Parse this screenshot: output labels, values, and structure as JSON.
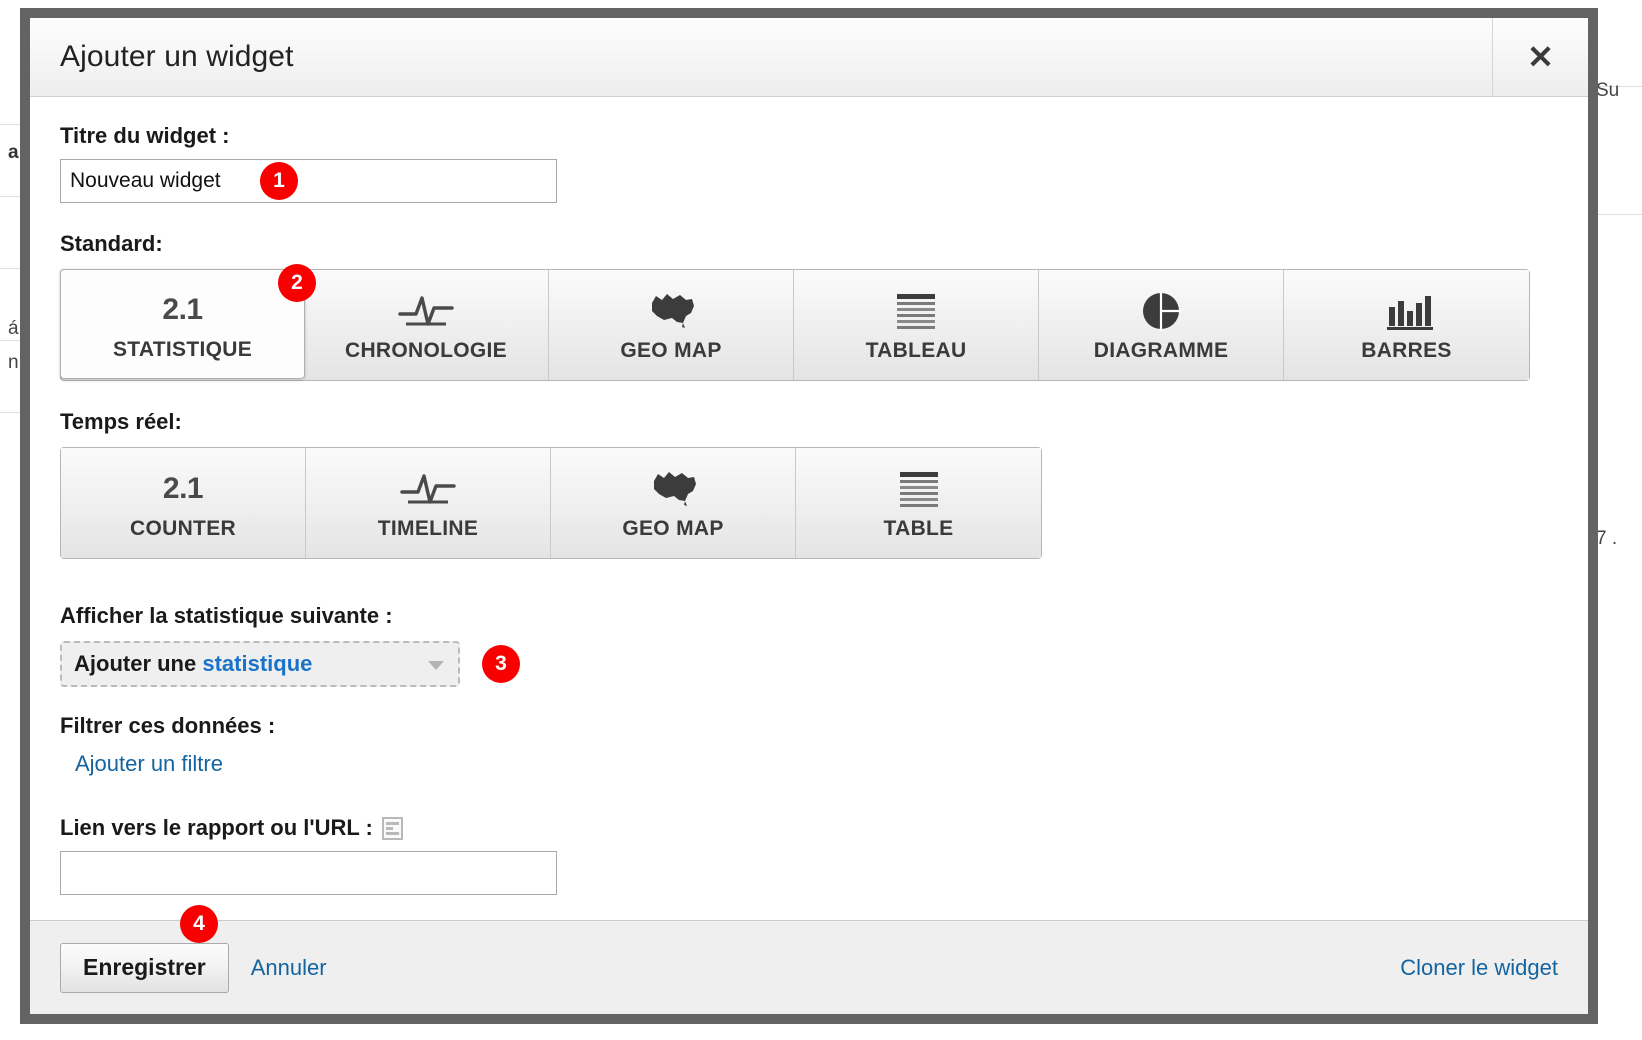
{
  "dialog": {
    "title": "Ajouter un widget",
    "close_icon": "close-icon"
  },
  "form": {
    "title_label": "Titre du widget :",
    "title_value": "Nouveau widget",
    "title_placeholder": "",
    "standard_label": "Standard:",
    "realtime_label": "Temps réel:",
    "statistic_label": "Afficher la statistique suivante :",
    "dropdown_prefix": "Ajouter une ",
    "dropdown_accent": "statistique",
    "filter_label": "Filtrer ces données :",
    "filter_link": "Ajouter un filtre",
    "url_label": "Lien vers le rapport ou l'URL :",
    "url_icon": "report-icon",
    "url_value": "",
    "url_placeholder": ""
  },
  "standard_types": [
    {
      "label": "STATISTIQUE",
      "icon": "numeral-2-1-icon",
      "icon_text": "2.1",
      "selected": true
    },
    {
      "label": "CHRONOLOGIE",
      "icon": "timeline-line-icon",
      "icon_text": "",
      "selected": false
    },
    {
      "label": "GEO MAP",
      "icon": "geo-map-icon",
      "icon_text": "",
      "selected": false
    },
    {
      "label": "TABLEAU",
      "icon": "table-rows-icon",
      "icon_text": "",
      "selected": false
    },
    {
      "label": "DIAGRAMME",
      "icon": "pie-chart-icon",
      "icon_text": "",
      "selected": false
    },
    {
      "label": "BARRES",
      "icon": "bar-chart-icon",
      "icon_text": "",
      "selected": false
    }
  ],
  "realtime_types": [
    {
      "label": "COUNTER",
      "icon": "numeral-2-1-icon",
      "icon_text": "2.1",
      "selected": false
    },
    {
      "label": "TIMELINE",
      "icon": "timeline-line-icon",
      "icon_text": "",
      "selected": false
    },
    {
      "label": "GEO MAP",
      "icon": "geo-map-icon",
      "icon_text": "",
      "selected": false
    },
    {
      "label": "TABLE",
      "icon": "table-rows-icon",
      "icon_text": "",
      "selected": false
    }
  ],
  "footer": {
    "save_label": "Enregistrer",
    "cancel_label": "Annuler",
    "clone_label": "Cloner le widget"
  },
  "badges": [
    {
      "number": "1",
      "target": "title-input"
    },
    {
      "number": "2",
      "target": "statistique-type-button"
    },
    {
      "number": "3",
      "target": "statistic-dropdown"
    },
    {
      "number": "4",
      "target": "save-button"
    }
  ],
  "background_fragments": {
    "left": [
      "a",
      "á",
      "n"
    ],
    "right": [
      "Su",
      "7 ."
    ]
  },
  "colors": {
    "badge_red": "#f90000",
    "link_blue": "#1464a0",
    "accent_blue": "#1a73c8",
    "modal_border": "#636363",
    "footer_bg": "#efefef"
  }
}
